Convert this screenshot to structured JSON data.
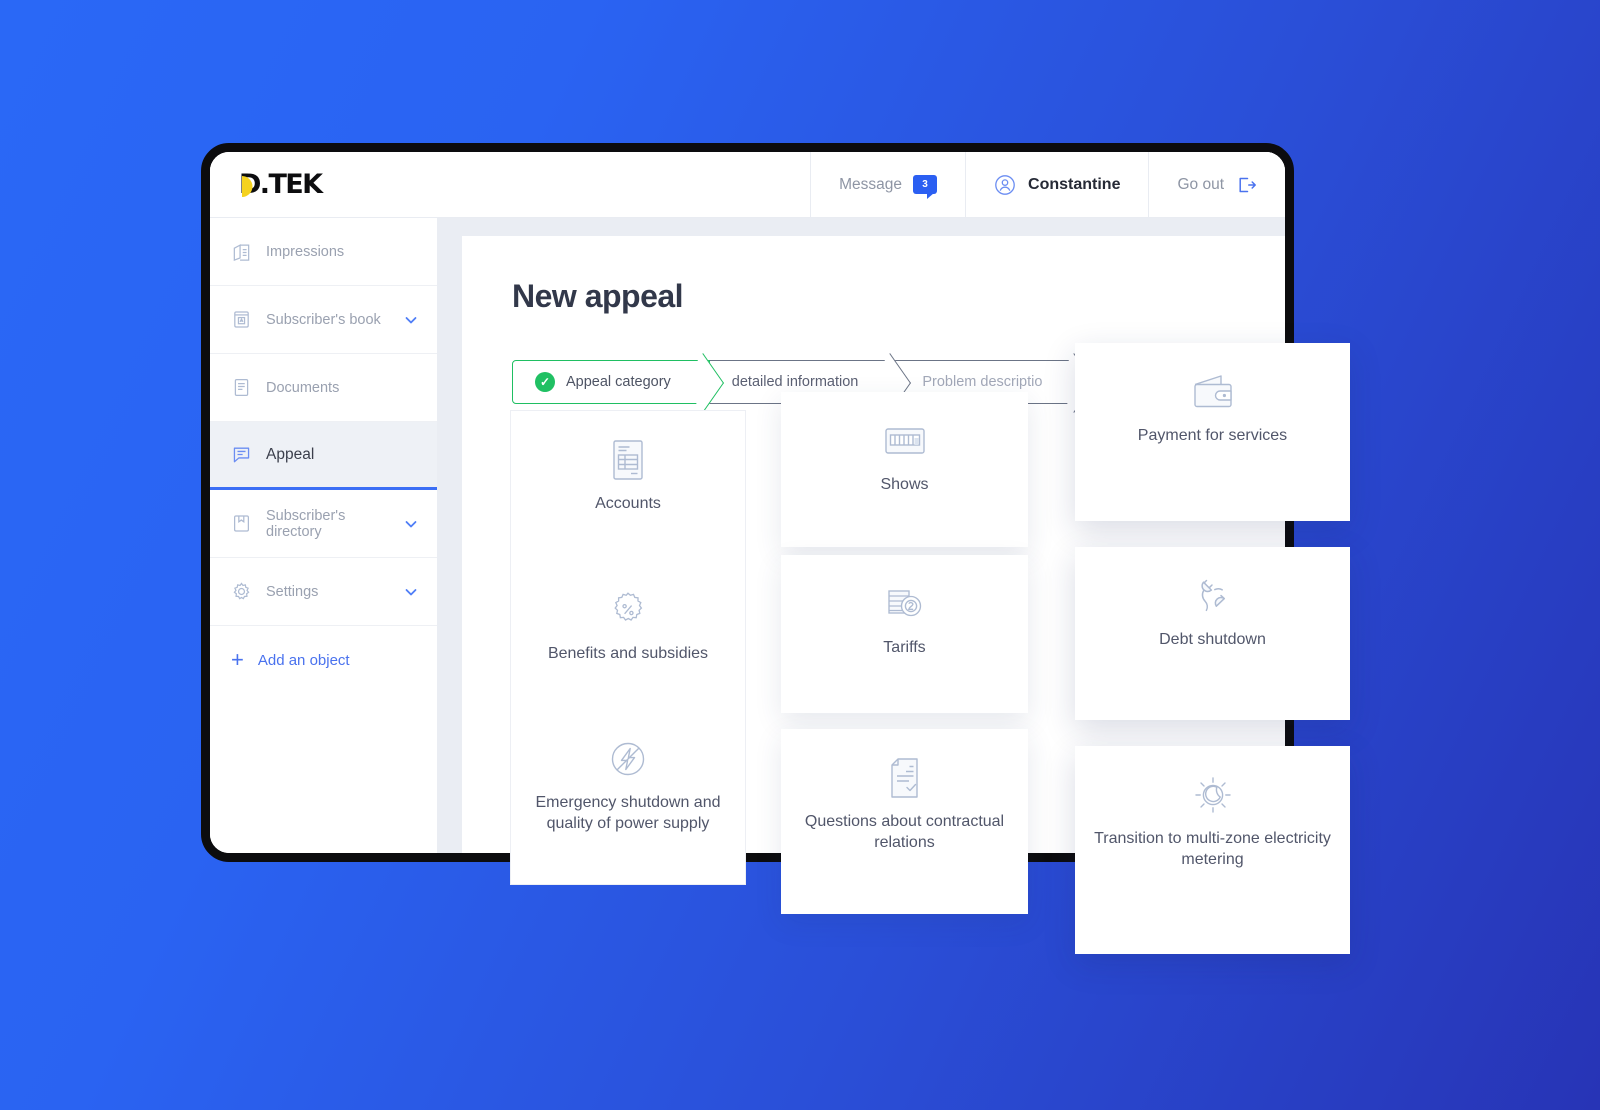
{
  "header": {
    "logo_text": "D.TEK",
    "nav": [
      {
        "label": "Message",
        "badge": "3",
        "icon": "message-icon"
      },
      {
        "label": "Constantine",
        "icon": "user-icon"
      },
      {
        "label": "Go out",
        "icon": "logout-icon"
      }
    ]
  },
  "sidebar": {
    "items": [
      {
        "label": "Impressions",
        "icon": "impressions-icon",
        "chevron": false,
        "active": false
      },
      {
        "label": "Subscriber's book",
        "icon": "book-icon",
        "chevron": true,
        "active": false
      },
      {
        "label": "Documents",
        "icon": "documents-icon",
        "chevron": false,
        "active": false
      },
      {
        "label": "Appeal",
        "icon": "appeal-icon",
        "chevron": false,
        "active": true
      },
      {
        "label": "Subscriber's directory",
        "icon": "directory-icon",
        "chevron": true,
        "active": false
      },
      {
        "label": "Settings",
        "icon": "gear-icon",
        "chevron": true,
        "active": false
      }
    ],
    "add_object": {
      "label": "Add an object",
      "icon": "plus-icon"
    }
  },
  "main": {
    "title": "New appeal",
    "steps": [
      {
        "label": "Appeal category",
        "state": "done",
        "check": "✓"
      },
      {
        "label": "detailed information",
        "state": "current"
      },
      {
        "label": "Problem descriptio",
        "state": "upcoming"
      }
    ],
    "cards": {
      "column1": [
        {
          "label": "Accounts",
          "icon": "accounts-document-icon"
        },
        {
          "label": "Benefits and subsidies",
          "icon": "percent-badge-icon"
        },
        {
          "label": "Emergency shutdown and quality of power supply",
          "icon": "lightning-circle-icon"
        }
      ],
      "column2": [
        {
          "label": "Shows",
          "icon": "meter-icon"
        },
        {
          "label": "Tariffs",
          "icon": "coins-icon"
        },
        {
          "label": "Questions about contractual relations",
          "icon": "contract-check-icon"
        }
      ],
      "column3": [
        {
          "label": "Payment for services",
          "icon": "wallet-icon"
        },
        {
          "label": "Debt shutdown",
          "icon": "unplugged-plug-icon"
        },
        {
          "label": "Transition to multi-zone electricity metering",
          "icon": "day-night-icon"
        }
      ]
    }
  },
  "colors": {
    "brand_blue": "#2b5ff2",
    "logo_yellow": "#f5d21f",
    "step_done_green": "#20c063",
    "accent_link": "#4a72ee",
    "icon_blue_gray": "#aebbd2",
    "background_gradient_from": "#2a68f6",
    "background_gradient_to": "#2734b6"
  }
}
